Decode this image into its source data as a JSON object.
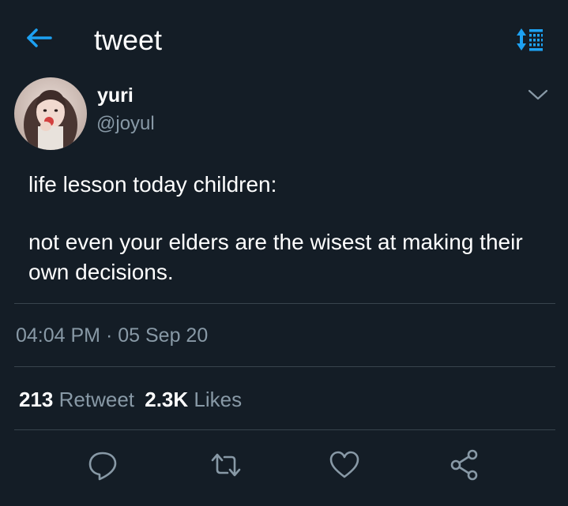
{
  "header": {
    "title": "tweet",
    "back_icon": "back-arrow-icon",
    "sort_icon": "sort-toggle-icon",
    "accent": "#1da1f2"
  },
  "author": {
    "display_name": "yuri",
    "handle": "@joyul"
  },
  "tweet": {
    "text_line1": "life lesson today children:",
    "text_line2": "not even your elders are the wisest at making their own decisions.",
    "time": "04:04 PM",
    "separator": " · ",
    "date": "05 Sep 20"
  },
  "stats": {
    "retweets_count": "213",
    "retweets_label": "Retweet",
    "likes_count": "2.3K",
    "likes_label": "Likes"
  },
  "actions": [
    "reply-icon",
    "retweet-icon",
    "like-icon",
    "share-icon"
  ],
  "colors": {
    "background": "#141d26",
    "muted_text": "#8899a6",
    "divider": "#38444d"
  }
}
